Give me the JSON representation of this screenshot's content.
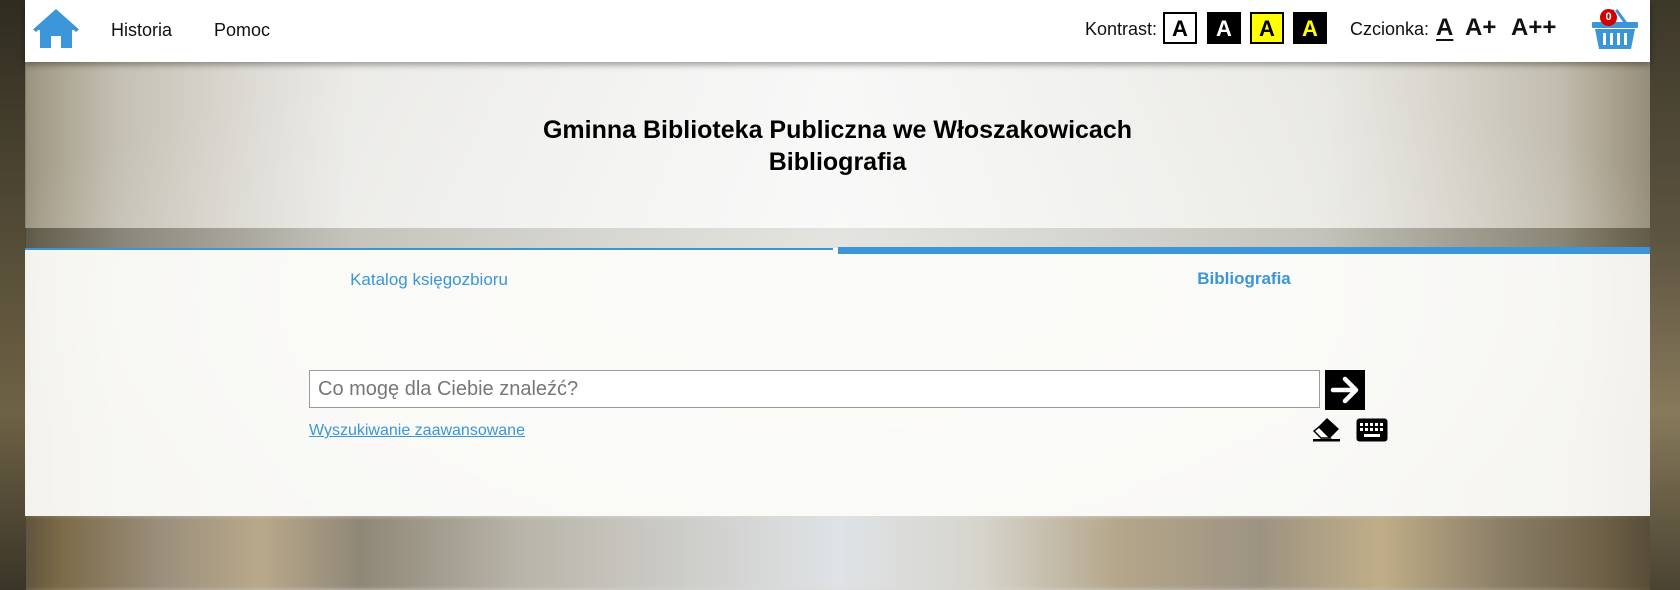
{
  "topbar": {
    "nav": [
      {
        "label": "Historia"
      },
      {
        "label": "Pomoc"
      }
    ],
    "contrast_label": "Kontrast:",
    "contrast_options": [
      {
        "label": "A",
        "bg": "#ffffff",
        "fg": "#000000"
      },
      {
        "label": "A",
        "bg": "#000000",
        "fg": "#ffffff"
      },
      {
        "label": "A",
        "bg": "#ffff00",
        "fg": "#000000"
      },
      {
        "label": "A",
        "bg": "#000000",
        "fg": "#ffff00"
      }
    ],
    "font_label": "Czcionka:",
    "font_options": [
      {
        "label": "A"
      },
      {
        "label": "A+"
      },
      {
        "label": "A++"
      }
    ],
    "cart_count": "0",
    "icons": {
      "home": "home-icon",
      "cart": "basket-icon"
    }
  },
  "header": {
    "line1": "Gminna Biblioteka Publiczna we Włoszakowicach",
    "line2": "Bibliografia"
  },
  "tabs": [
    {
      "label": "Katalog księgozbioru",
      "active": false
    },
    {
      "label": "Bibliografia",
      "active": true
    }
  ],
  "search": {
    "placeholder": "Co mogę dla Ciebie znaleźć?",
    "value": "",
    "advanced_link": "Wyszukiwanie zaawansowane",
    "icons": {
      "submit": "arrow-right-icon",
      "clear": "eraser-icon",
      "keyboard": "keyboard-icon"
    }
  },
  "colors": {
    "accent": "#3a96d8",
    "badge": "#d40000"
  }
}
